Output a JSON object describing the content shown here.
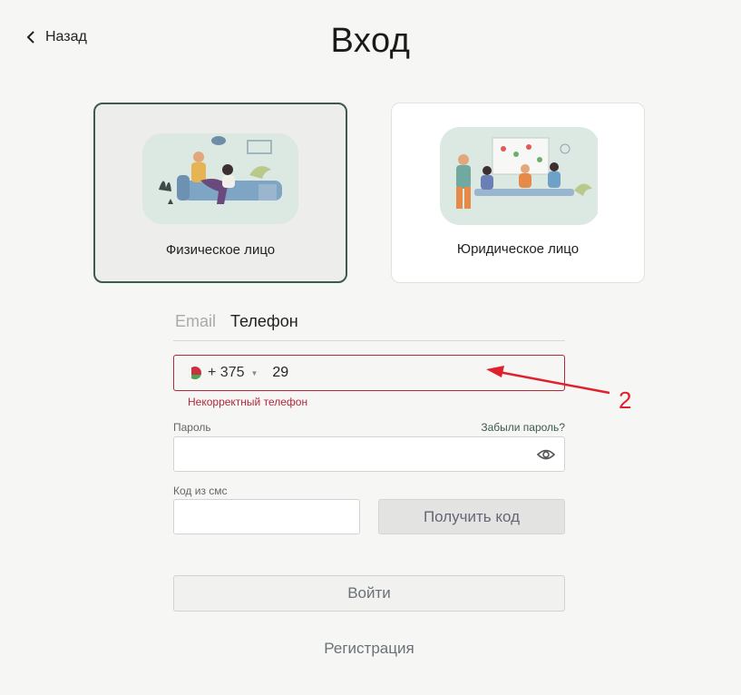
{
  "nav": {
    "back_label": "Назад"
  },
  "page": {
    "title": "Вход"
  },
  "cards": {
    "individual": {
      "label": "Физическое лицо",
      "selected": true
    },
    "legal": {
      "label": "Юридическое лицо",
      "selected": false
    }
  },
  "tabs": [
    {
      "label": "Email",
      "active": false
    },
    {
      "label": "Телефон",
      "active": true
    }
  ],
  "phone": {
    "country_icon": "belarus-flag-icon",
    "country_code": "+ 375",
    "value": "29",
    "error": "Некорректный телефон"
  },
  "password": {
    "label": "Пароль",
    "forgot_label": "Забыли пароль?",
    "value": ""
  },
  "sms": {
    "label": "Код из смс",
    "value": "",
    "get_code_label": "Получить код"
  },
  "actions": {
    "login_label": "Войти",
    "register_label": "Регистрация"
  },
  "annotation": {
    "number": "2",
    "color": "#e0202a"
  },
  "colors": {
    "accent": "#3e5a4e",
    "error": "#b4283c",
    "background": "#f6f6f4"
  }
}
